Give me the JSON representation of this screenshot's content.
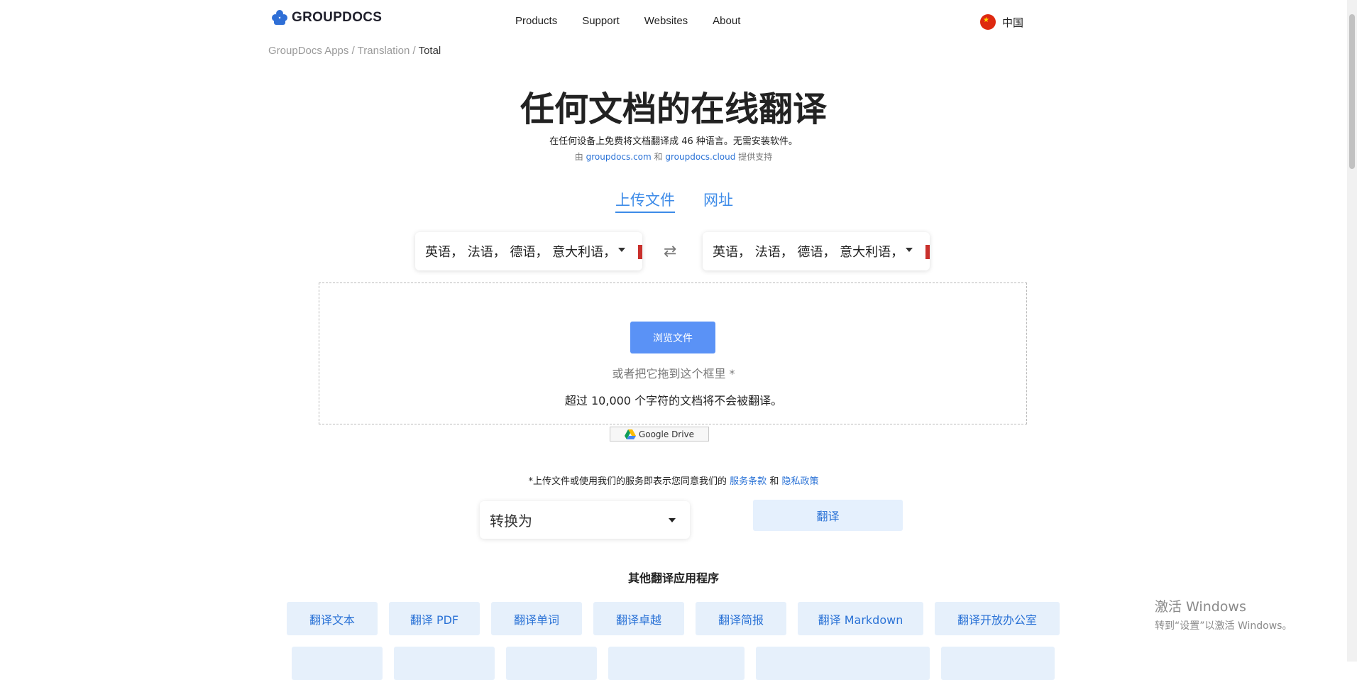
{
  "header": {
    "logo_text": "GROUPDOCS",
    "nav": [
      "Products",
      "Support",
      "Websites",
      "About"
    ],
    "locale": "中国"
  },
  "breadcrumb": {
    "items": [
      "GroupDocs Apps",
      "Translation"
    ],
    "separator": "/",
    "current": "Total"
  },
  "hero": {
    "title": "任何文档的在线翻译",
    "subtitle": "在任何设备上免费将文档翻译成 46 种语言。无需安装软件。",
    "powered_prefix": "由",
    "powered_link1": "groupdocs.com",
    "powered_and": "和",
    "powered_link2": "groupdocs.cloud",
    "powered_suffix": "提供支持"
  },
  "tabs": {
    "upload": "上传文件",
    "url": "网址"
  },
  "languages": {
    "source": "英语， 法语， 德语， 意大利语，",
    "target": "英语， 法语， 德语， 意大利语，",
    "swap_icon": "swap-arrows-icon"
  },
  "upload": {
    "browse": "浏览文件",
    "drag_hint": "或者把它拖到这个框里 *",
    "limit": "超过 10,000 个字符的文档将不会被翻译。",
    "google_drive": "Google Drive"
  },
  "terms": {
    "prefix": "*上传文件或使用我们的服务即表示您同意我们的",
    "tos": "服务条款",
    "and": "和",
    "privacy": "隐私政策"
  },
  "convert": {
    "label": "转换为",
    "translate": "翻译"
  },
  "other_apps": {
    "title": "其他翻译应用程序",
    "row1": [
      "翻译文本",
      "翻译 PDF",
      "翻译单词",
      "翻译卓越",
      "翻译简报",
      "翻译 Markdown",
      "翻译开放办公室"
    ]
  },
  "watermark": {
    "line1": "激活 Windows",
    "line2": "转到“设置”以激活 Windows。"
  },
  "colors": {
    "accent": "#3d8be8",
    "button": "#5a92f6",
    "chip_bg": "#e6f0fb"
  }
}
